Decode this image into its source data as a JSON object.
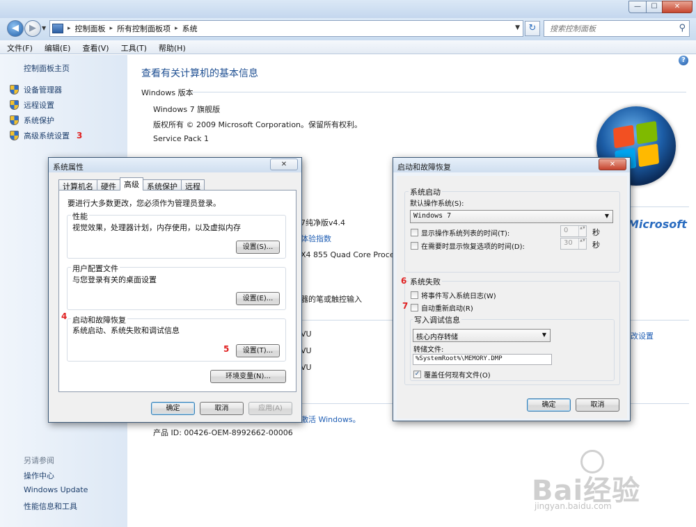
{
  "window": {
    "minimize_glyph": "—",
    "maximize_glyph": "☐",
    "close_glyph": "✕"
  },
  "nav": {
    "back_glyph": "◀",
    "forward_glyph": "▶",
    "breadcrumbs": [
      "控制面板",
      "所有控制面板项",
      "系统"
    ],
    "separator": "▸",
    "dropdown_glyph": "▼",
    "refresh_glyph": "↻",
    "search_placeholder": "搜索控制面板",
    "search_glyph": "⚲"
  },
  "menu": [
    "文件(F)",
    "编辑(E)",
    "查看(V)",
    "工具(T)",
    "帮助(H)"
  ],
  "left_pane": {
    "home": "控制面板主页",
    "links": [
      "设备管理器",
      "远程设置",
      "系统保护",
      "高级系统设置"
    ],
    "step_3": "3",
    "see_also_label": "另请参阅",
    "see_also": [
      "操作中心",
      "Windows Update",
      "性能信息和工具"
    ]
  },
  "main": {
    "help_glyph": "?",
    "title": "查看有关计算机的基本信息",
    "windows_edition_label": "Windows 版本",
    "edition": "Windows 7 旗舰版",
    "copyright": "版权所有 © 2009 Microsoft Corporation。保留所有权利。",
    "service_pack": "Service Pack 1",
    "brand": "Microsoft",
    "frag_version": "7纯净版v4.4",
    "frag_experience": "体验指数",
    "frag_cpu": "X4 855 Quad Core Proces",
    "frag_pen": "器的笔或触控输入",
    "frag_wu1": "VU",
    "frag_change_settings": "改设置",
    "frag_wu2": "VU",
    "frag_wu3": "VU",
    "frag_activate": "激活 Windows。",
    "product_id": "产品 ID: 00426-OEM-8992662-00006"
  },
  "sysprops": {
    "title": "系统属性",
    "close_glyph": "✕",
    "tabs": [
      "计算机名",
      "硬件",
      "高级",
      "系统保护",
      "远程"
    ],
    "admin_note": "要进行大多数更改，您必须作为管理员登录。",
    "performance": {
      "label": "性能",
      "desc": "视觉效果，处理器计划，内存使用，以及虚拟内存",
      "button": "设置(S)..."
    },
    "profiles": {
      "label": "用户配置文件",
      "desc": "与您登录有关的桌面设置",
      "button": "设置(E)..."
    },
    "startup": {
      "label": "启动和故障恢复",
      "desc": "系统启动、系统失败和调试信息",
      "button": "设置(T)...",
      "step_4": "4",
      "step_5": "5"
    },
    "env_button": "环境变量(N)...",
    "ok": "确定",
    "cancel": "取消",
    "apply": "应用(A)"
  },
  "startup_recovery": {
    "title": "启动和故障恢复",
    "close_glyph": "✕",
    "system_startup": "系统启动",
    "default_os_label": "默认操作系统(S):",
    "default_os": "Windows 7",
    "show_os_list": "显示操作系统列表的时间(T):",
    "show_os_list_value": "0",
    "show_recovery": "在需要时显示恢复选项的时间(D):",
    "show_recovery_value": "30",
    "seconds": "秒",
    "spin_glyph": "▲▼",
    "system_failure": "系统失败",
    "step_6": "6",
    "write_event": "将事件写入系统日志(W)",
    "auto_restart": "自动重新启动(R)",
    "step_7": "7",
    "debug_info": "写入调试信息",
    "debug_type": "核心内存转储",
    "dump_file_label": "转储文件:",
    "dump_file": "%SystemRoot%\\MEMORY.DMP",
    "overwrite": "覆盖任何现有文件(O)",
    "check_glyph": "✓",
    "ok": "确定",
    "cancel": "取消"
  },
  "watermark": {
    "brand": "Bai经验",
    "url": "jingyan.baidu.com"
  },
  "colors": {
    "accent_link": "#1f5eb4",
    "step_number": "#e02020",
    "close_red": "#c7462f"
  }
}
